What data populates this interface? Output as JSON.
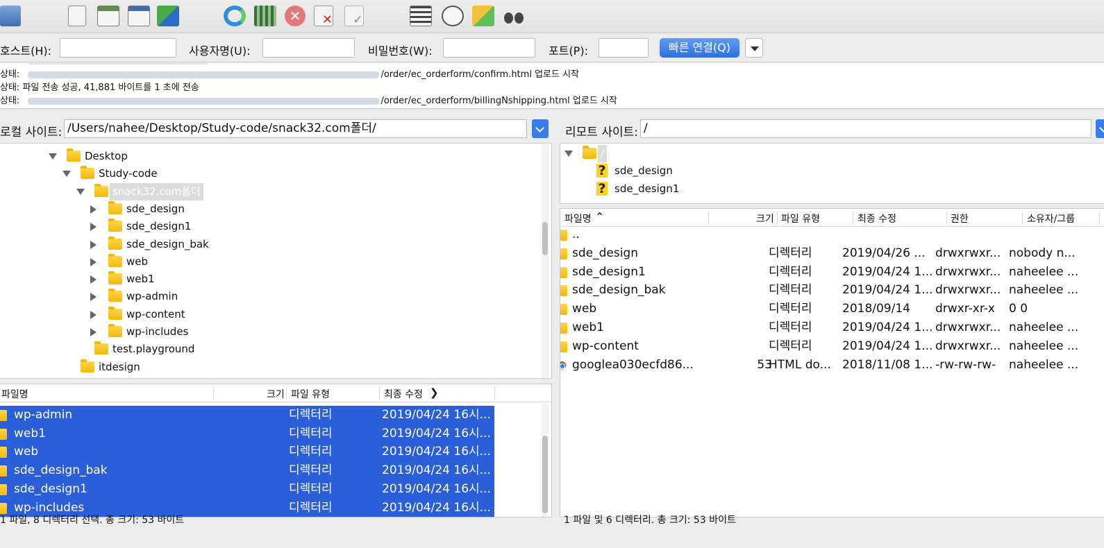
{
  "toolbar": {
    "icons": [
      "site-manager-icon",
      "log-toggle-icon",
      "local-tree-toggle-icon",
      "remote-tree-toggle-icon",
      "transfer-queue-icon",
      "refresh-icon",
      "filter-settings-icon",
      "cancel-icon",
      "disconnect-icon",
      "reconnect-icon",
      "directory-listing-icon",
      "search-files-icon",
      "sync-browse-icon",
      "binoculars-icon"
    ]
  },
  "quickconnect": {
    "host_label": "호스트(H):",
    "user_label": "사용자명(U):",
    "password_label": "비밀번호(W):",
    "port_label": "포트(P):",
    "connect_button": "빠른 연결(Q)",
    "host_value": "",
    "user_value": "",
    "password_value": "",
    "port_value": ""
  },
  "log": {
    "lines": [
      {
        "prefix": "상태:",
        "text": "/order/ec_orderform/confirm.html 업로드 시작"
      },
      {
        "prefix": "상태:",
        "text": "파일 전송 성공, 41,881 바이트를 1 초에 전송"
      },
      {
        "prefix": "상태:",
        "text": "/order/ec_orderform/billingNshipping.html 업로드 시작"
      }
    ]
  },
  "local": {
    "site_label": "로컬 사이트:",
    "site_path": "/Users/nahee/Desktop/Study-code/snack32.com폴더/",
    "tree": [
      {
        "label": "Desktop",
        "arrow": "down"
      },
      {
        "label": "Study-code",
        "arrow": "down"
      },
      {
        "label": "snack32.com폴더",
        "arrow": "down"
      },
      {
        "label": "sde_design",
        "arrow": "right"
      },
      {
        "label": "sde_design1",
        "arrow": "right"
      },
      {
        "label": "sde_design_bak",
        "arrow": "right"
      },
      {
        "label": "web",
        "arrow": "right"
      },
      {
        "label": "web1",
        "arrow": "right"
      },
      {
        "label": "wp-admin",
        "arrow": "right"
      },
      {
        "label": "wp-content",
        "arrow": "right"
      },
      {
        "label": "wp-includes",
        "arrow": "right"
      },
      {
        "label": "test.playground",
        "arrow": ""
      },
      {
        "label": "itdesign",
        "arrow": ""
      }
    ],
    "columns": [
      "파일명",
      "크기",
      "파일 유형",
      "최종 수정"
    ],
    "files": [
      {
        "name": "wp-admin",
        "size": "",
        "type": "디렉터리",
        "modified": "2019/04/24 16시..."
      },
      {
        "name": "web1",
        "size": "",
        "type": "디렉터리",
        "modified": "2019/04/24 16시..."
      },
      {
        "name": "web",
        "size": "",
        "type": "디렉터리",
        "modified": "2019/04/24 16시..."
      },
      {
        "name": "sde_design_bak",
        "size": "",
        "type": "디렉터리",
        "modified": "2019/04/24 16시..."
      },
      {
        "name": "sde_design1",
        "size": "",
        "type": "디렉터리",
        "modified": "2019/04/24 16시..."
      },
      {
        "name": "wp-includes",
        "size": "",
        "type": "디렉터리",
        "modified": "2019/04/24 16시..."
      }
    ],
    "status": "1 파일, 8 디렉터리 선택. 총 크기: 53 바이트"
  },
  "remote": {
    "site_label": "리모트 사이트:",
    "site_path": "/",
    "tree": [
      {
        "label": "/",
        "arrow": "down",
        "icon": "folder"
      },
      {
        "label": "sde_design",
        "arrow": "",
        "icon": "question"
      },
      {
        "label": "sde_design1",
        "arrow": "",
        "icon": "question"
      }
    ],
    "columns": [
      "파일명",
      "크기",
      "파일 유형",
      "최종 수정",
      "권한",
      "소유자/그룹"
    ],
    "files": [
      {
        "name": "..",
        "size": "",
        "type": "",
        "modified": "",
        "perms": "",
        "owner": "",
        "icon": "folder"
      },
      {
        "name": "sde_design",
        "size": "",
        "type": "디렉터리",
        "modified": "2019/04/26 ...",
        "perms": "drwxrwxr...",
        "owner": "nobody n...",
        "icon": "folder"
      },
      {
        "name": "sde_design1",
        "size": "",
        "type": "디렉터리",
        "modified": "2019/04/24 1...",
        "perms": "drwxrwxr...",
        "owner": "naheelee ...",
        "icon": "folder"
      },
      {
        "name": "sde_design_bak",
        "size": "",
        "type": "디렉터리",
        "modified": "2019/04/24 1...",
        "perms": "drwxrwxr...",
        "owner": "naheelee ...",
        "icon": "folder"
      },
      {
        "name": "web",
        "size": "",
        "type": "디렉터리",
        "modified": "2018/09/14",
        "perms": "drwxr-xr-x",
        "owner": "0 0",
        "icon": "folder"
      },
      {
        "name": "web1",
        "size": "",
        "type": "디렉터리",
        "modified": "2019/04/24 1...",
        "perms": "drwxrwxr...",
        "owner": "naheelee ...",
        "icon": "folder"
      },
      {
        "name": "wp-content",
        "size": "",
        "type": "디렉터리",
        "modified": "2019/04/24 1...",
        "perms": "drwxrwxr...",
        "owner": "naheelee ...",
        "icon": "folder"
      },
      {
        "name": "googlea030ecfd86...",
        "size": "53",
        "type": "HTML do...",
        "modified": "2018/11/08 1...",
        "perms": "-rw-rw-rw-",
        "owner": "naheelee ...",
        "icon": "chrome"
      }
    ],
    "status": "1 파일 및 6 디렉터리. 총 크기: 53 바이트"
  },
  "colors": {
    "selection": "#2b5fd9",
    "accent": "#3b7de8",
    "folder": "#f4b90a"
  }
}
